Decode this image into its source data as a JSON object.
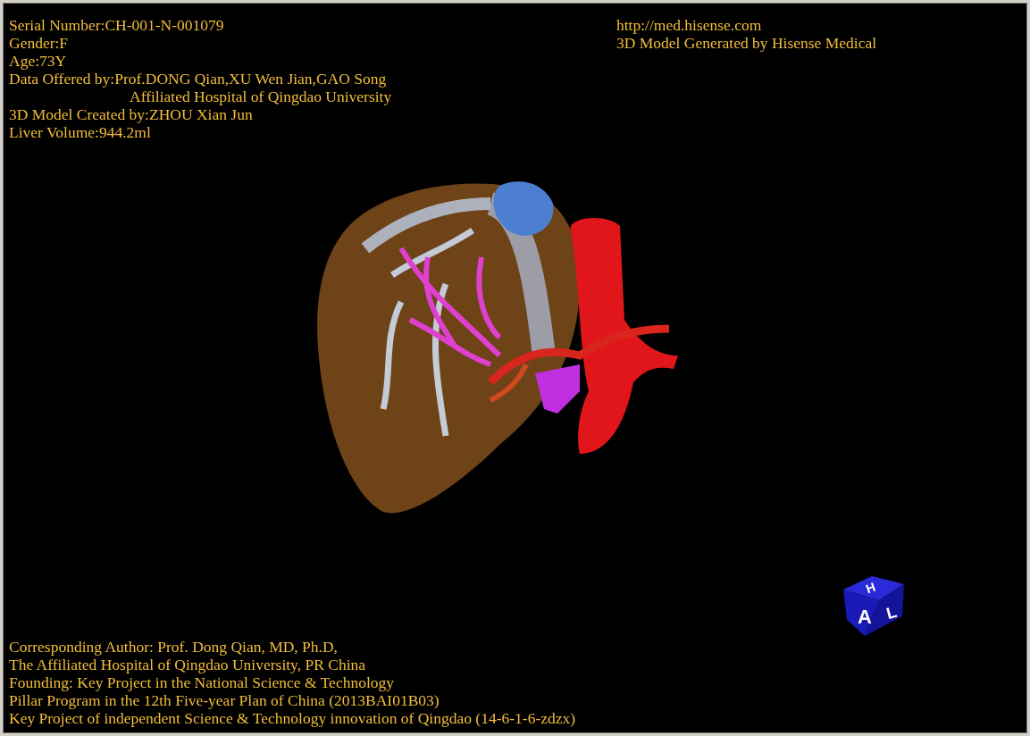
{
  "case_info": [
    {
      "kind": "line",
      "text": "Serial Number:CH-001-N-001079"
    },
    {
      "kind": "line",
      "text": "Gender:F"
    },
    {
      "kind": "line",
      "text": "Age:73Y"
    },
    {
      "kind": "line",
      "text": "Data Offered by:Prof.DONG Qian,XU Wen Jian,GAO Song"
    },
    {
      "kind": "indent",
      "text": "Affiliated Hospital of Qingdao University"
    },
    {
      "kind": "line",
      "text": "3D Model Created by:ZHOU Xian Jun"
    },
    {
      "kind": "line",
      "text": "Liver Volume:944.2ml"
    }
  ],
  "branding": [
    "http://med.hisense.com",
    "3D Model Generated by Hisense Medical"
  ],
  "credits": [
    "Corresponding Author: Prof. Dong Qian, MD, Ph.D,",
    "The Affiliated Hospital of Qingdao University, PR China",
    "Founding: Key Project in the National Science & Technology",
    "Pillar Program in the 12th Five-year Plan of China (2013BAI01B03)",
    "Key Project of independent Science & Technology innovation of Qingdao (14-6-1-6-zdzx)"
  ],
  "orientation_cube": {
    "top": "H",
    "front": "A",
    "side": "L"
  }
}
